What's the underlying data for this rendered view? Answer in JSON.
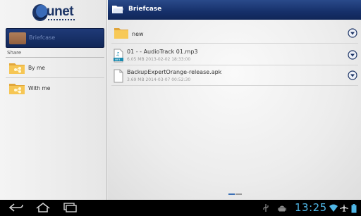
{
  "app": {
    "logo_text": "unet",
    "header_title": "Briefcase",
    "accent_color": "#1a3470",
    "status_time_color": "#4fb6e6"
  },
  "sidebar": {
    "briefcase_label": "Briefcase",
    "share_header": "Share",
    "share_items": [
      {
        "label": "By me",
        "icon": "shared-folder-icon"
      },
      {
        "label": "With me",
        "icon": "shared-folder-icon"
      }
    ]
  },
  "files": [
    {
      "name": "new",
      "meta": "",
      "type": "folder",
      "icon": "folder-icon"
    },
    {
      "name": "01 -  - AudioTrack 01.mp3",
      "meta": "6.05 MB 2013-02-02 18:33:00",
      "type": "mp3",
      "icon": "mp3-file-icon"
    },
    {
      "name": "BackupExpertOrange-release.apk",
      "meta": "3.69 MB 2014-03-07 00:52:30",
      "type": "apk",
      "icon": "document-icon"
    }
  ],
  "status_bar": {
    "time": "13:25",
    "icons": [
      "usb-icon",
      "android-debug-icon",
      "wifi-icon",
      "airplane-mode-icon",
      "battery-icon"
    ]
  },
  "nav_buttons": [
    "back-icon",
    "home-icon",
    "recent-apps-icon"
  ]
}
